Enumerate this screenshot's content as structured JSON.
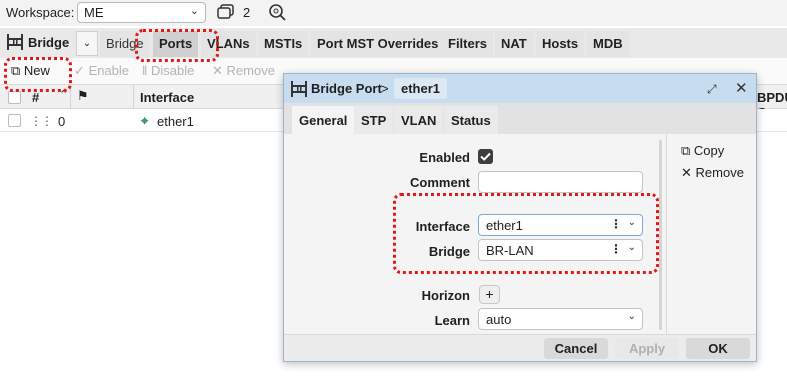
{
  "workspace": {
    "label": "Workspace:",
    "value": "ME",
    "window_count": "2"
  },
  "bridge_title": "Bridge",
  "tabs": [
    {
      "label": "Bridge"
    },
    {
      "label": "Ports"
    },
    {
      "label": "VLANs"
    },
    {
      "label": "MSTIs"
    },
    {
      "label": "Port MST Overrides"
    },
    {
      "label": "Filters"
    },
    {
      "label": "NAT"
    },
    {
      "label": "Hosts"
    },
    {
      "label": "MDB"
    }
  ],
  "toolbar": {
    "new": "New",
    "enable": "Enable",
    "disable": "Disable",
    "remove": "Remove"
  },
  "table": {
    "headers": {
      "num": "#",
      "interface": "Interface",
      "bpdu": "BPDU G"
    },
    "rows": [
      {
        "num": "0",
        "interface": "ether1"
      }
    ]
  },
  "dialog": {
    "title": "Bridge Port",
    "crumb_sep": ">",
    "crumb": "ether1",
    "tabs": [
      {
        "label": "General"
      },
      {
        "label": "STP"
      },
      {
        "label": "VLAN"
      },
      {
        "label": "Status"
      }
    ],
    "fields": {
      "enabled": {
        "label": "Enabled",
        "checked": true
      },
      "comment": {
        "label": "Comment",
        "value": ""
      },
      "interface": {
        "label": "Interface",
        "value": "ether1"
      },
      "bridge": {
        "label": "Bridge",
        "value": "BR-LAN"
      },
      "horizon": {
        "label": "Horizon"
      },
      "learn": {
        "label": "Learn",
        "value": "auto"
      }
    },
    "side": {
      "copy": "Copy",
      "remove": "Remove"
    },
    "footer": {
      "cancel": "Cancel",
      "apply": "Apply",
      "ok": "OK"
    }
  },
  "colors": {
    "highlight": "#e01919",
    "dialog_header": "#c7dcef",
    "interface_icon": "#2e8b57"
  }
}
